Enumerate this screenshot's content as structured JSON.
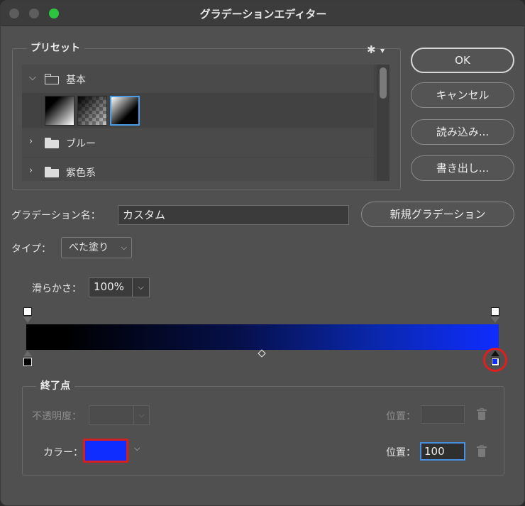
{
  "window": {
    "title": "グラデーションエディター"
  },
  "presets": {
    "legend": "プリセット",
    "folders": [
      {
        "label": "基本",
        "expanded": true
      },
      {
        "label": "ブルー",
        "expanded": false
      },
      {
        "label": "紫色系",
        "expanded": false
      }
    ]
  },
  "buttons": {
    "ok": "OK",
    "cancel": "キャンセル",
    "load": "読み込み...",
    "save": "書き出し...",
    "new_gradient": "新規グラデーション"
  },
  "gradient_name": {
    "label": "グラデーション名：",
    "value": "カスタム"
  },
  "type": {
    "label": "タイプ：",
    "value": "べた塗り"
  },
  "smoothness": {
    "label": "滑らかさ：",
    "value": "100%"
  },
  "gradient_bar": {
    "colors": [
      "#000000",
      "#0f2dff"
    ],
    "selected_stop": "color-stop-right"
  },
  "end_point": {
    "legend": "終了点",
    "opacity_label": "不透明度：",
    "opacity_value": "",
    "opacity_position_label": "位置：",
    "opacity_position_value": "",
    "color_label": "カラー：",
    "color_value": "#0f2dff",
    "color_position_label": "位置：",
    "color_position_value": "100"
  },
  "icons": {
    "gear": "gear-icon",
    "chevron_down": "chevron-down-icon",
    "chevron_right": "chevron-right-icon",
    "folder": "folder-icon",
    "trash": "trash-icon"
  }
}
